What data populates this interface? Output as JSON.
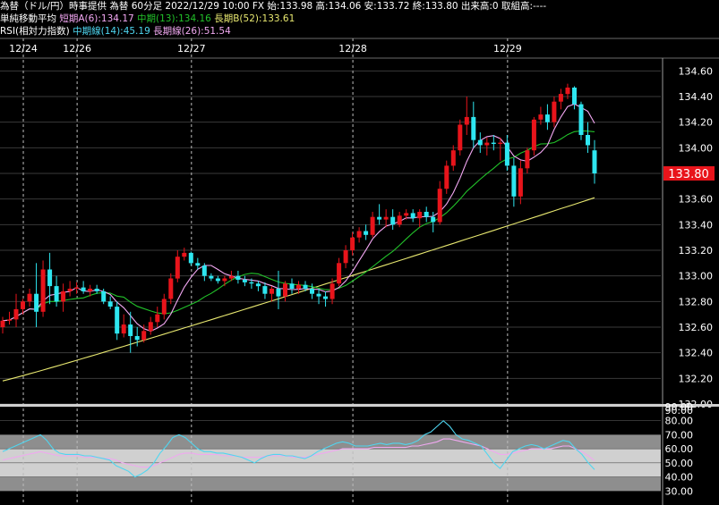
{
  "header": {
    "line1": "為替（ドル/円）時事提供 為替 60分足 2022/12/29 10:00 FX 始:133.98 高:134.06 安:133.72 終:133.80 出来高:0 取組高:----",
    "ma_title": "単純移動平均",
    "ma_short": "短期A(6):134.17",
    "ma_mid": "中期(13):134.16",
    "ma_long": "長期B(52):133.61",
    "rsi_title": "RSI(相対力指数)",
    "rsi_mid": "中期線(14):45.19",
    "rsi_long": "長期線(26):51.54"
  },
  "colors": {
    "up": "#e8141b",
    "down": "#2ee6f0",
    "ma_short": "#f4a8f4",
    "ma_mid": "#22c22a",
    "ma_long": "#e8e870",
    "rsi_mid": "#4fd6f0",
    "rsi_long": "#f0a8f0",
    "price_tag": "#e8141b",
    "grid": "#3a3a3a"
  },
  "chart_data": [
    {
      "type": "candlestick",
      "title": "為替（ドル/円）60分足",
      "x_labels": [
        "12/24",
        "12/26",
        "12/27",
        "12/28",
        "12/29"
      ],
      "y_ticks": [
        "132.00",
        "132.20",
        "132.40",
        "132.60",
        "132.80",
        "133.00",
        "133.20",
        "133.40",
        "133.60",
        "133.80",
        "134.00",
        "134.20",
        "134.40",
        "134.60"
      ],
      "ylim": [
        132.0,
        134.7
      ],
      "last_price": "133.80",
      "candles": [
        [
          132.6,
          132.68,
          132.55,
          132.65
        ],
        [
          132.65,
          132.72,
          132.62,
          132.66
        ],
        [
          132.66,
          132.86,
          132.6,
          132.74
        ],
        [
          132.74,
          132.82,
          132.7,
          132.8
        ],
        [
          132.8,
          132.9,
          132.76,
          132.86
        ],
        [
          132.86,
          133.1,
          132.6,
          132.72
        ],
        [
          132.72,
          133.12,
          132.68,
          133.05
        ],
        [
          133.05,
          133.18,
          132.78,
          132.92
        ],
        [
          132.92,
          133.0,
          132.76,
          132.8
        ],
        [
          132.8,
          132.94,
          132.72,
          132.88
        ],
        [
          132.88,
          132.96,
          132.84,
          132.9
        ],
        [
          132.9,
          132.95,
          132.86,
          132.91
        ],
        [
          132.91,
          132.96,
          132.86,
          132.88
        ],
        [
          132.88,
          132.93,
          132.84,
          132.9
        ],
        [
          132.9,
          132.93,
          132.86,
          132.88
        ],
        [
          132.88,
          132.9,
          132.78,
          132.8
        ],
        [
          132.8,
          132.84,
          132.74,
          132.76
        ],
        [
          132.76,
          132.8,
          132.5,
          132.55
        ],
        [
          132.55,
          132.7,
          132.52,
          132.62
        ],
        [
          132.62,
          132.72,
          132.4,
          132.53
        ],
        [
          132.53,
          132.6,
          132.45,
          132.5
        ],
        [
          132.5,
          132.62,
          132.48,
          132.57
        ],
        [
          132.57,
          132.68,
          132.54,
          132.64
        ],
        [
          132.64,
          132.76,
          132.6,
          132.7
        ],
        [
          132.7,
          132.86,
          132.66,
          132.82
        ],
        [
          132.82,
          133.02,
          132.78,
          132.98
        ],
        [
          132.98,
          133.2,
          132.95,
          133.15
        ],
        [
          133.15,
          133.22,
          133.12,
          133.18
        ],
        [
          133.18,
          133.19,
          133.08,
          133.1
        ],
        [
          133.1,
          133.14,
          133.05,
          133.08
        ],
        [
          133.08,
          133.1,
          132.96,
          133.0
        ],
        [
          133.0,
          133.02,
          132.96,
          132.98
        ],
        [
          132.98,
          133.0,
          132.94,
          132.96
        ],
        [
          132.96,
          133.0,
          132.92,
          132.98
        ],
        [
          132.98,
          133.04,
          132.96,
          133.0
        ],
        [
          133.0,
          133.04,
          132.94,
          132.97
        ],
        [
          132.97,
          133.0,
          132.92,
          132.95
        ],
        [
          132.95,
          132.98,
          132.9,
          132.94
        ],
        [
          132.94,
          132.96,
          132.88,
          132.92
        ],
        [
          132.92,
          132.95,
          132.82,
          132.86
        ],
        [
          132.86,
          132.92,
          132.8,
          132.9
        ],
        [
          132.9,
          133.04,
          132.74,
          132.84
        ],
        [
          132.84,
          132.96,
          132.8,
          132.94
        ],
        [
          132.94,
          132.98,
          132.86,
          132.9
        ],
        [
          132.9,
          132.96,
          132.86,
          132.93
        ],
        [
          132.93,
          132.96,
          132.88,
          132.9
        ],
        [
          132.9,
          132.94,
          132.82,
          132.86
        ],
        [
          132.86,
          132.9,
          132.78,
          132.84
        ],
        [
          132.84,
          132.88,
          132.76,
          132.82
        ],
        [
          132.82,
          132.98,
          132.78,
          132.94
        ],
        [
          132.94,
          133.14,
          132.92,
          133.1
        ],
        [
          133.1,
          133.24,
          133.06,
          133.2
        ],
        [
          133.2,
          133.34,
          133.16,
          133.3
        ],
        [
          133.3,
          133.38,
          133.26,
          133.35
        ],
        [
          133.35,
          133.4,
          133.28,
          133.32
        ],
        [
          133.32,
          133.5,
          133.3,
          133.46
        ],
        [
          133.46,
          133.56,
          133.4,
          133.44
        ],
        [
          133.44,
          133.52,
          133.38,
          133.46
        ],
        [
          133.46,
          133.52,
          133.36,
          133.4
        ],
        [
          133.4,
          133.5,
          133.38,
          133.47
        ],
        [
          133.47,
          133.52,
          133.44,
          133.49
        ],
        [
          133.49,
          133.52,
          133.42,
          133.45
        ],
        [
          133.45,
          133.52,
          133.38,
          133.5
        ],
        [
          133.5,
          133.54,
          133.42,
          133.46
        ],
        [
          133.46,
          133.5,
          133.34,
          133.42
        ],
        [
          133.42,
          133.74,
          133.4,
          133.68
        ],
        [
          133.68,
          133.9,
          133.64,
          133.86
        ],
        [
          133.86,
          134.02,
          133.82,
          133.98
        ],
        [
          133.98,
          134.22,
          133.94,
          134.18
        ],
        [
          134.18,
          134.4,
          134.1,
          134.24
        ],
        [
          134.24,
          134.36,
          134.0,
          134.06
        ],
        [
          134.06,
          134.12,
          133.96,
          134.02
        ],
        [
          134.02,
          134.08,
          133.94,
          134.04
        ],
        [
          134.04,
          134.1,
          133.98,
          134.03
        ],
        [
          134.03,
          134.08,
          133.9,
          134.04
        ],
        [
          134.04,
          134.1,
          133.82,
          133.86
        ],
        [
          133.86,
          133.92,
          133.54,
          133.62
        ],
        [
          133.62,
          133.9,
          133.56,
          133.84
        ],
        [
          133.84,
          134.0,
          133.8,
          133.98
        ],
        [
          133.98,
          134.24,
          133.94,
          134.22
        ],
        [
          134.22,
          134.32,
          134.18,
          134.26
        ],
        [
          134.26,
          134.34,
          134.14,
          134.2
        ],
        [
          134.2,
          134.4,
          134.16,
          134.36
        ],
        [
          134.36,
          134.46,
          134.3,
          134.42
        ],
        [
          134.42,
          134.5,
          134.38,
          134.47
        ],
        [
          134.47,
          134.48,
          134.3,
          134.34
        ],
        [
          134.34,
          134.36,
          134.06,
          134.1
        ],
        [
          134.1,
          134.2,
          133.96,
          134.02
        ],
        [
          133.98,
          134.06,
          133.72,
          133.8
        ]
      ]
    },
    {
      "type": "line",
      "title": "RSI(相対力指数)",
      "y_ticks": [
        "30.00",
        "40.00",
        "50.00",
        "60.00",
        "70.00",
        "80.00",
        "90.00"
      ],
      "ylim": [
        20,
        90
      ],
      "series": [
        {
          "name": "中期線(14)",
          "values": [
            58,
            60,
            62,
            64,
            66,
            68,
            70,
            66,
            60,
            57,
            56,
            56,
            56,
            55,
            55,
            54,
            53,
            52,
            48,
            46,
            44,
            40,
            42,
            45,
            50,
            57,
            62,
            68,
            70,
            68,
            64,
            60,
            58,
            58,
            57,
            57,
            56,
            55,
            54,
            52,
            50,
            53,
            55,
            56,
            56,
            55,
            55,
            54,
            53,
            55,
            58,
            60,
            62,
            64,
            65,
            64,
            62,
            62,
            62,
            63,
            64,
            63,
            64,
            64,
            63,
            64,
            66,
            70,
            72,
            76,
            80,
            76,
            70,
            67,
            66,
            64,
            62,
            56,
            50,
            46,
            52,
            58,
            60,
            62,
            63,
            62,
            60,
            62,
            64,
            66,
            65,
            60,
            56,
            50,
            45.19
          ]
        },
        {
          "name": "長期線(26)",
          "values": [
            52,
            53,
            54,
            55,
            56,
            57,
            58,
            57,
            56,
            55,
            55,
            55,
            55,
            54,
            54,
            54,
            53,
            53,
            52,
            50,
            49,
            48,
            47,
            47,
            48,
            50,
            52,
            54,
            56,
            57,
            57,
            56,
            56,
            56,
            56,
            55,
            55,
            55,
            54,
            54,
            54,
            54,
            55,
            55,
            55,
            55,
            54,
            54,
            54,
            55,
            56,
            57,
            58,
            59,
            60,
            60,
            60,
            60,
            60,
            61,
            61,
            61,
            61,
            61,
            61,
            62,
            62,
            63,
            64,
            65,
            67,
            67,
            66,
            65,
            64,
            63,
            62,
            60,
            58,
            56,
            56,
            57,
            58,
            59,
            60,
            60,
            60,
            60,
            61,
            62,
            62,
            60,
            58,
            55,
            51.54
          ]
        }
      ]
    }
  ]
}
